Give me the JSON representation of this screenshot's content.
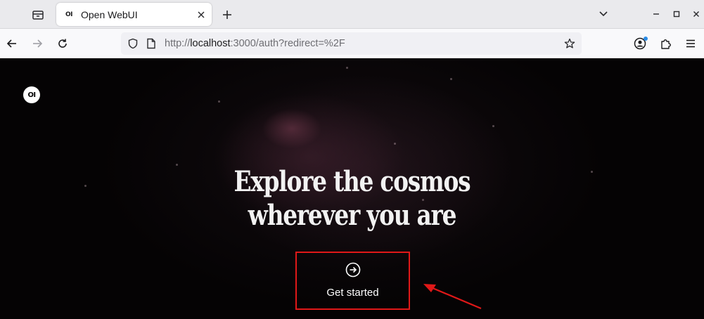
{
  "browser": {
    "tab": {
      "favicon_text": "OI",
      "title": "Open WebUI"
    },
    "url": {
      "scheme": "http://",
      "host": "localhost",
      "rest": ":3000/auth?redirect=%2F"
    },
    "icons": {
      "tab_overview": "tab-overview-icon",
      "close_tab": "close-icon",
      "new_tab": "plus-icon",
      "list_tabs": "chevron-down-icon",
      "back": "arrow-left-icon",
      "forward": "arrow-right-icon",
      "reload": "reload-icon",
      "shield": "shield-icon",
      "page": "page-icon",
      "bookmark": "star-icon",
      "account": "account-icon",
      "extensions": "puzzle-icon",
      "menu": "hamburger-menu-icon"
    }
  },
  "page": {
    "logo_text": "OI",
    "hero_line_1": "Explore the cosmos",
    "hero_line_2": "wherever you are",
    "cta_label": "Get started",
    "cta_icon": "arrow-right-circle-icon"
  },
  "colors": {
    "annotation_red": "#e01818",
    "background": "#050304",
    "text": "#f2f2f2"
  }
}
